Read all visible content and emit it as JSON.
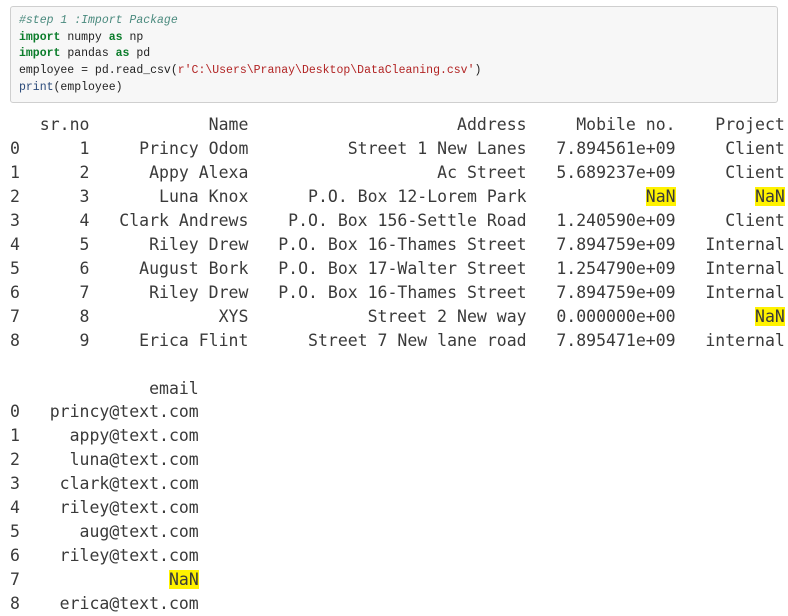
{
  "code": {
    "l1": "#step 1 :Import Package",
    "l2a": "import",
    "l2b": "numpy",
    "l2c": "as",
    "l2d": "np",
    "l3a": "import",
    "l3b": "pandas",
    "l3c": "as",
    "l3d": "pd",
    "l4a": "employee = pd.read_csv(",
    "l4b": "r'C:\\Users\\Pranay\\Desktop\\DataCleaning.csv'",
    "l4c": ")",
    "l5a": "print",
    "l5b": "(employee)"
  },
  "df": {
    "slash": "\\",
    "hdr": {
      "idx": "",
      "srno": "sr.no",
      "name": "Name",
      "addr": "Address",
      "mob": "Mobile no.",
      "proj": "Project"
    },
    "rows": [
      {
        "idx": "0",
        "srno": "1",
        "name": "Princy Odom",
        "addr": "Street 1 New Lanes",
        "mob": "7.894561e+09",
        "proj": "Client",
        "nan_mob": false,
        "nan_proj": false
      },
      {
        "idx": "1",
        "srno": "2",
        "name": "Appy Alexa",
        "addr": "Ac Street",
        "mob": "5.689237e+09",
        "proj": "Client",
        "nan_mob": false,
        "nan_proj": false
      },
      {
        "idx": "2",
        "srno": "3",
        "name": "Luna Knox",
        "addr": "P.O. Box 12-Lorem Park",
        "mob": "NaN",
        "proj": "NaN",
        "nan_mob": true,
        "nan_proj": true
      },
      {
        "idx": "3",
        "srno": "4",
        "name": "Clark Andrews",
        "addr": "P.O. Box 156-Settle Road",
        "mob": "1.240590e+09",
        "proj": "Client",
        "nan_mob": false,
        "nan_proj": false
      },
      {
        "idx": "4",
        "srno": "5",
        "name": "Riley Drew",
        "addr": "P.O. Box 16-Thames Street",
        "mob": "7.894759e+09",
        "proj": "Internal",
        "nan_mob": false,
        "nan_proj": false
      },
      {
        "idx": "5",
        "srno": "6",
        "name": "August Bork",
        "addr": "P.O. Box 17-Walter Street",
        "mob": "1.254790e+09",
        "proj": "Internal",
        "nan_mob": false,
        "nan_proj": false
      },
      {
        "idx": "6",
        "srno": "7",
        "name": "Riley Drew",
        "addr": "P.O. Box 16-Thames Street",
        "mob": "7.894759e+09",
        "proj": "Internal",
        "nan_mob": false,
        "nan_proj": false
      },
      {
        "idx": "7",
        "srno": "8",
        "name": "XYS",
        "addr": "Street 2 New way",
        "mob": "0.000000e+00",
        "proj": "NaN",
        "nan_mob": false,
        "nan_proj": true
      },
      {
        "idx": "8",
        "srno": "9",
        "name": "Erica Flint",
        "addr": "Street 7 New lane road",
        "mob": "7.895471e+09",
        "proj": "internal",
        "nan_mob": false,
        "nan_proj": false
      }
    ],
    "ehdr": {
      "idx": "",
      "email": "email"
    },
    "erows": [
      {
        "idx": "0",
        "email": "princy@text.com",
        "nan": false
      },
      {
        "idx": "1",
        "email": "appy@text.com",
        "nan": false
      },
      {
        "idx": "2",
        "email": "luna@text.com",
        "nan": false
      },
      {
        "idx": "3",
        "email": "clark@text.com",
        "nan": false
      },
      {
        "idx": "4",
        "email": "riley@text.com",
        "nan": false
      },
      {
        "idx": "5",
        "email": "aug@text.com",
        "nan": false
      },
      {
        "idx": "6",
        "email": "riley@text.com",
        "nan": false
      },
      {
        "idx": "7",
        "email": "NaN",
        "nan": true
      },
      {
        "idx": "8",
        "email": "erica@text.com",
        "nan": false
      }
    ]
  }
}
